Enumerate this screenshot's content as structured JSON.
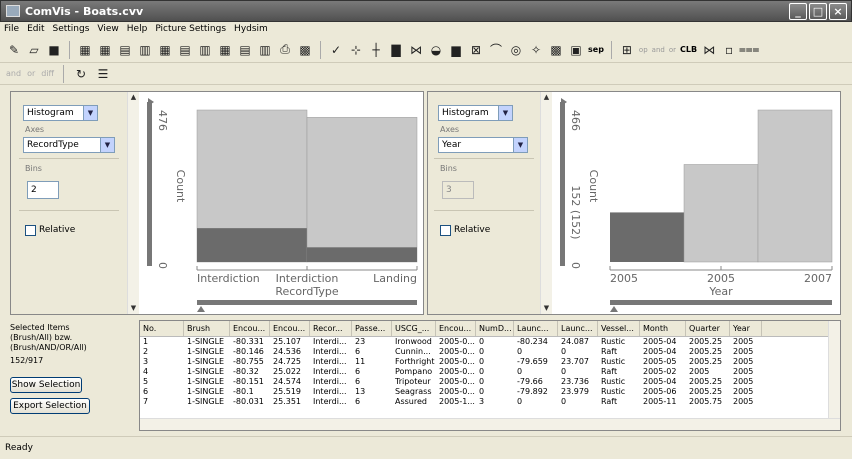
{
  "window": {
    "title": "ComVis - Boats.cvv"
  },
  "menu": [
    "File",
    "Edit",
    "Settings",
    "View",
    "Help",
    "Picture Settings",
    "Hydsim"
  ],
  "toolbar": {
    "sep_label": "sep",
    "op_label": "op",
    "and_label": "and",
    "or_label": "or",
    "clb_label": "CLB"
  },
  "toolbar2": {
    "and_label": "and",
    "or_label": "or",
    "diff_label": "diff"
  },
  "left_view": {
    "type_select": "Histogram",
    "axes_label": "Axes",
    "axes_select": "RecordType",
    "bins_label": "Bins",
    "bins_value": "2",
    "relative_label": "Relative"
  },
  "right_view": {
    "type_select": "Histogram",
    "axes_label": "Axes",
    "axes_select": "Year",
    "bins_label": "Bins",
    "bins_value": "3",
    "relative_label": "Relative"
  },
  "chart_data": [
    {
      "type": "bar",
      "xlabel": "RecordType",
      "ylabel": "Count",
      "ylim": [
        0,
        476
      ],
      "x_tick_labels": [
        "Interdiction",
        "Interdiction",
        "Landing"
      ],
      "y_tick_labels": [
        "0",
        "476"
      ],
      "categories": [
        "Interdiction",
        "Landing"
      ],
      "series": [
        {
          "name": "All",
          "values": [
            476,
            453
          ]
        },
        {
          "name": "Selected",
          "values": [
            106,
            46
          ]
        }
      ],
      "colors": {
        "all": "#c8c8c8",
        "selected": "#6b6b6b"
      }
    },
    {
      "type": "bar",
      "xlabel": "Year",
      "ylabel": "Count",
      "ylim": [
        0,
        466
      ],
      "x_tick_labels": [
        "2005",
        "2005",
        "2007"
      ],
      "y_tick_labels": [
        "0",
        "152 (152)",
        "466"
      ],
      "categories": [
        "2005",
        "2006",
        "2007"
      ],
      "series": [
        {
          "name": "Selected",
          "values": [
            152,
            0,
            0
          ]
        },
        {
          "name": "All",
          "values": [
            0,
            299,
            466
          ]
        }
      ],
      "colors": {
        "all": "#c8c8c8",
        "selected": "#6b6b6b"
      }
    }
  ],
  "selection": {
    "label_lines": [
      "Selected Items",
      "(Brush/All) bzw.",
      "(Brush/AND/OR/All)"
    ],
    "count": "152/917",
    "show_button": "Show Selection",
    "export_button": "Export Selection"
  },
  "table": {
    "columns": [
      "No.",
      "Brush",
      "Encou...",
      "Encou...",
      "Recor...",
      "Passe...",
      "USCG_...",
      "Encou...",
      "NumD...",
      "Launc...",
      "Launc...",
      "Vessel...",
      "Month",
      "Quarter",
      "Year"
    ],
    "rows": [
      [
        "1",
        "1-SINGLE",
        "-80.331",
        "25.107",
        "Interdi...",
        "23",
        "Ironwood",
        "2005-0...",
        "0",
        "-80.234",
        "24.087",
        "Rustic",
        "2005-04",
        "2005.25",
        "2005"
      ],
      [
        "2",
        "1-SINGLE",
        "-80.146",
        "24.536",
        "Interdi...",
        "6",
        "Cunnin...",
        "2005-0...",
        "0",
        "0",
        "0",
        "Raft",
        "2005-04",
        "2005.25",
        "2005"
      ],
      [
        "3",
        "1-SINGLE",
        "-80.755",
        "24.725",
        "Interdi...",
        "11",
        "Forthright",
        "2005-0...",
        "0",
        "-79.659",
        "23.707",
        "Rustic",
        "2005-05",
        "2005.25",
        "2005"
      ],
      [
        "4",
        "1-SINGLE",
        "-80.32",
        "25.022",
        "Interdi...",
        "6",
        "Pompano",
        "2005-0...",
        "0",
        "0",
        "0",
        "Raft",
        "2005-02",
        "2005",
        "2005"
      ],
      [
        "5",
        "1-SINGLE",
        "-80.151",
        "24.574",
        "Interdi...",
        "6",
        "Tripoteur",
        "2005-0...",
        "0",
        "-79.66",
        "23.736",
        "Rustic",
        "2005-04",
        "2005.25",
        "2005"
      ],
      [
        "6",
        "1-SINGLE",
        "-80.1",
        "25.519",
        "Interdi...",
        "13",
        "Seagrass",
        "2005-0...",
        "0",
        "-79.892",
        "23.979",
        "Rustic",
        "2005-06",
        "2005.25",
        "2005"
      ],
      [
        "7",
        "1-SINGLE",
        "-80.031",
        "25.351",
        "Interdi...",
        "6",
        "Assured",
        "2005-1...",
        "3",
        "0",
        "0",
        "Raft",
        "2005-11",
        "2005.75",
        "2005"
      ]
    ]
  },
  "status": {
    "text": "Ready"
  }
}
